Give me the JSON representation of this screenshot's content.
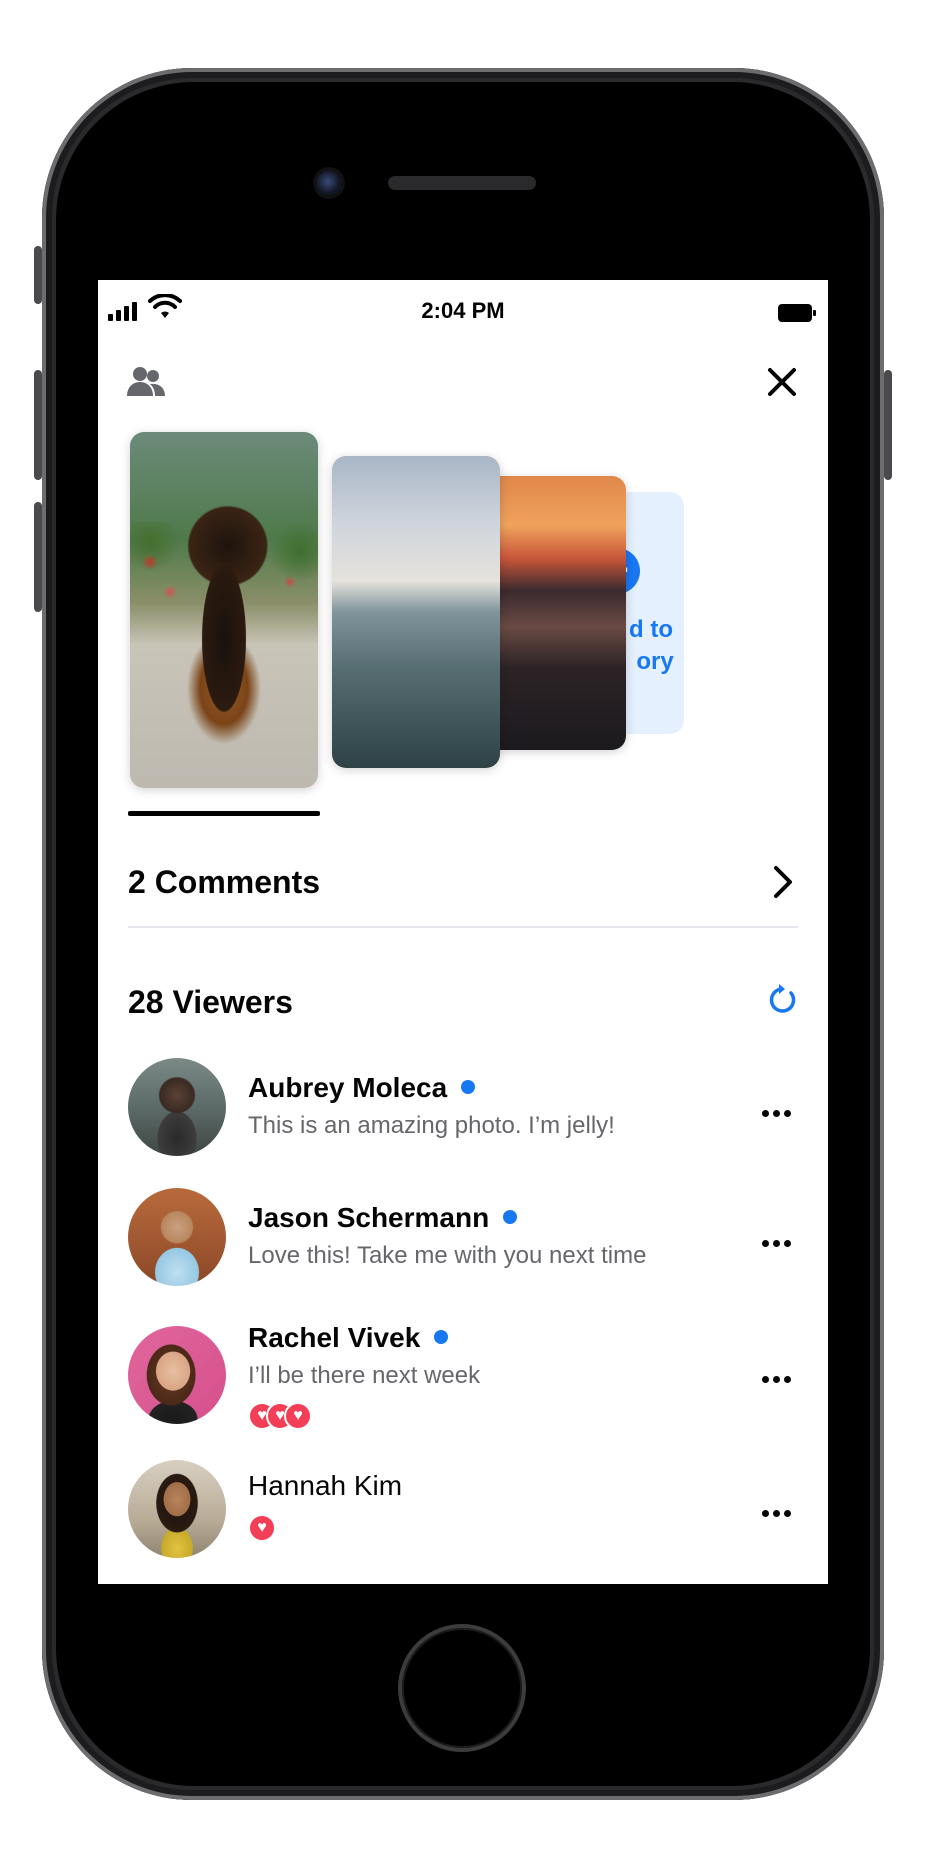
{
  "status_bar": {
    "time": "2:04 PM"
  },
  "header": {
    "friends_icon": "friends-icon",
    "close_icon": "close-icon"
  },
  "stories": {
    "items": [
      "puppy-photo",
      "sea-photo",
      "sunset-beach-photo"
    ],
    "add_to_story": {
      "icon": "plus-icon",
      "label_line1": "d to",
      "label_line2": "ory"
    }
  },
  "comments": {
    "title": "2 Comments",
    "icon": "chevron-right-icon"
  },
  "viewers": {
    "title": "28 Viewers",
    "refresh_icon": "refresh-icon",
    "list": [
      {
        "name": "Aubrey Moleca",
        "online": true,
        "message": "This is an amazing photo. I’m jelly!",
        "reactions": 0
      },
      {
        "name": "Jason Schermann",
        "online": true,
        "message": "Love this! Take me with you next time",
        "reactions": 0
      },
      {
        "name": "Rachel Vivek",
        "online": true,
        "message": "I’ll be there next week",
        "reactions": 3
      },
      {
        "name": "Hannah Kim",
        "online": false,
        "message": "",
        "reactions": 1
      }
    ]
  },
  "colors": {
    "accent": "#1877f2",
    "heart": "#f33e58",
    "text_primary": "#050505",
    "text_secondary": "#65676b"
  }
}
